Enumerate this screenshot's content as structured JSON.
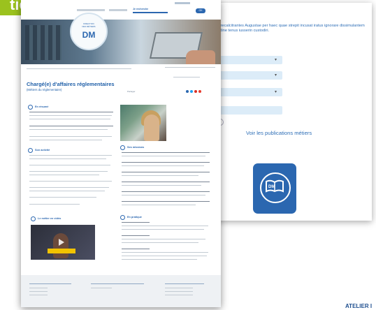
{
  "badge": {
    "text": "tiers"
  },
  "back_page": {
    "intro_text": "totati recalcitrantes Augustae per haec quae strepit incusat iratus ignorare dissimulantem formidine tenus iusserin custodiri.",
    "publications_title": "Voir les publications métiers",
    "tile_logo": "DM"
  },
  "front_page": {
    "hero_logo_lines": [
      "DIRECTION",
      "DES MÉTIERS",
      "DM"
    ],
    "page_title": "Chargé(e) d'affaires réglementaires",
    "page_subtitle": "(Métiers du réglementaire)",
    "active_nav": "Je recherche",
    "top_button": "OK",
    "section_labels": [
      "En résumé",
      "Son activité",
      "Ses missions",
      "En pratique",
      "Le métier en vidéo"
    ],
    "share_label": "Partager",
    "colors": {
      "brand_blue": "#2b67b0",
      "badge_green": "#9bc21e",
      "share_icons": [
        "#2b67b0",
        "#1da1f2",
        "#d93025",
        "#e63b2e"
      ]
    }
  },
  "watermark": {
    "text": "ATELIER I"
  }
}
